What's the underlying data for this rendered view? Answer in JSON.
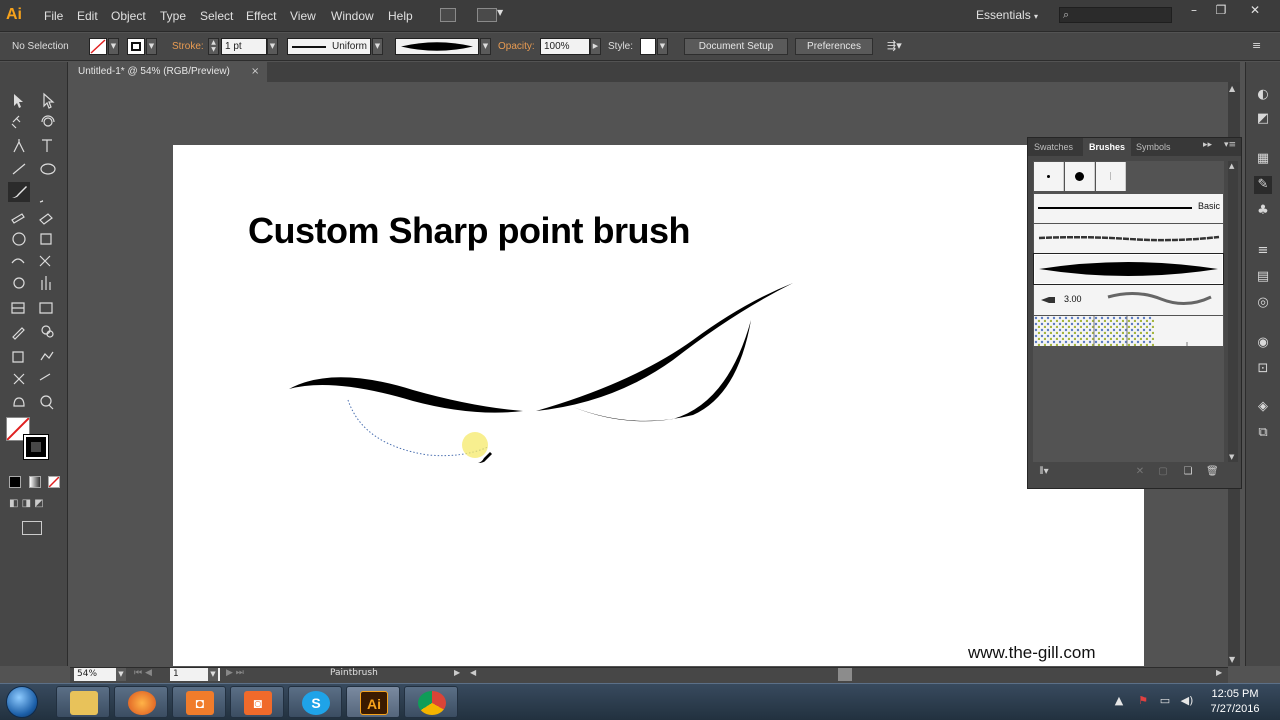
{
  "app": {
    "logo": "Ai",
    "workspace": "Essentials"
  },
  "menu": {
    "items": [
      "File",
      "Edit",
      "Object",
      "Type",
      "Select",
      "Effect",
      "View",
      "Window",
      "Help"
    ]
  },
  "control_bar": {
    "selection": "No Selection",
    "stroke_label": "Stroke:",
    "stroke_weight": "1 pt",
    "profile": "Uniform",
    "opacity_label": "Opacity:",
    "opacity_value": "100%",
    "style_label": "Style:",
    "document_setup": "Document Setup",
    "preferences": "Preferences"
  },
  "document": {
    "tab_title": "Untitled-1* @ 54% (RGB/Preview)",
    "close": "×"
  },
  "artboard": {
    "title": "Custom Sharp point brush",
    "watermark": "www.the-gill.com"
  },
  "brushes_panel": {
    "tabs": [
      "Swatches",
      "Brushes",
      "Symbols"
    ],
    "active_tab": "Brushes",
    "basic_label": "Basic",
    "scatter_value": "3.00"
  },
  "status_bar": {
    "zoom": "54%",
    "page": "1",
    "tool": "Paintbrush"
  },
  "taskbar": {
    "time": "12:05 PM",
    "date": "7/27/2016",
    "apps": [
      "file-explorer",
      "firefox",
      "orange-app",
      "orange-app-2",
      "skype",
      "illustrator",
      "chrome"
    ]
  },
  "colors": {
    "accent": "#f7a21b",
    "ui_dark": "#3c3c3c",
    "ui_mid": "#535353"
  }
}
